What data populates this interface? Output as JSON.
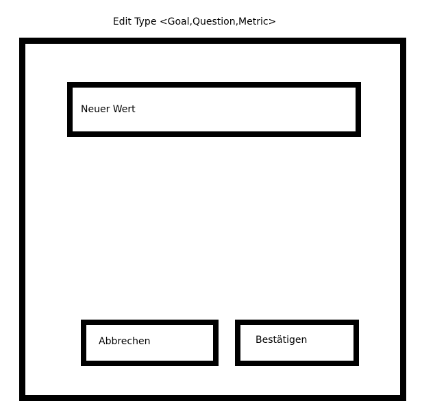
{
  "dialog": {
    "title": "Edit Type <Goal,Question,Metric>",
    "value_field": {
      "placeholder": "Neuer Wert"
    },
    "buttons": {
      "cancel_label": "Abbrechen",
      "confirm_label": "Bestätigen"
    }
  }
}
